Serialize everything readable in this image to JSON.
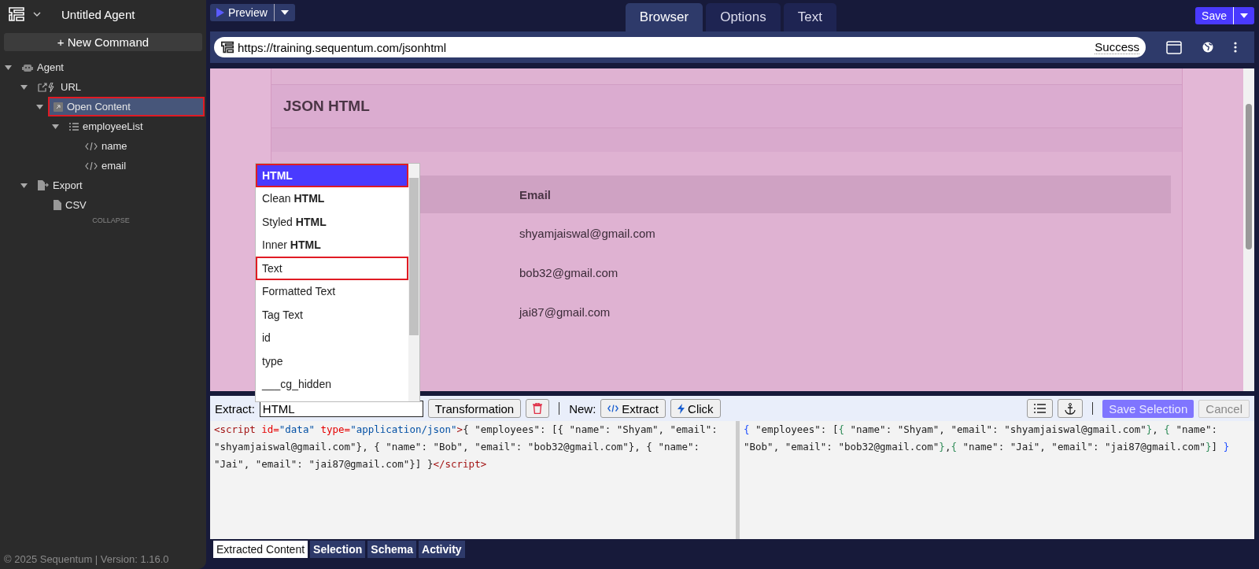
{
  "sidebar": {
    "agent_name": "Untitled Agent",
    "new_command": "+ New Command",
    "tree": [
      {
        "label": "Agent",
        "kind": "robot",
        "expanded": true,
        "selected": false,
        "annotated": false,
        "children": [
          {
            "label": "URL",
            "kind": "url",
            "expanded": true,
            "selected": false,
            "annotated": false,
            "children": [
              {
                "label": "Open Content",
                "kind": "open",
                "expanded": true,
                "selected": true,
                "annotated": true,
                "children": [
                  {
                    "label": "employeeList",
                    "kind": "list",
                    "expanded": true,
                    "selected": false,
                    "annotated": false,
                    "children": [
                      {
                        "label": "name",
                        "kind": "code",
                        "selected": false,
                        "annotated": false
                      },
                      {
                        "label": "email",
                        "kind": "code",
                        "selected": false,
                        "annotated": false
                      }
                    ]
                  }
                ]
              }
            ]
          },
          {
            "label": "Export",
            "kind": "export",
            "expanded": true,
            "selected": false,
            "annotated": false,
            "children": [
              {
                "label": "CSV",
                "kind": "file",
                "selected": false,
                "annotated": false
              }
            ]
          }
        ]
      }
    ],
    "collapse": "COLLAPSE",
    "footer": "© 2025 Sequentum | Version: 1.16.0"
  },
  "toolbar": {
    "preview": "Preview",
    "save": "Save"
  },
  "tabs": [
    {
      "label": "Browser",
      "selected": true
    },
    {
      "label": "Options",
      "selected": false
    },
    {
      "label": "Text",
      "selected": false
    }
  ],
  "address_bar": {
    "url": "https://training.sequentum.com/jsonhtml",
    "status": "Success"
  },
  "web_page": {
    "title": "JSON HTML",
    "column": "Email",
    "rows": [
      "shyamjaiswal@gmail.com",
      "bob32@gmail.com",
      "jai87@gmail.com"
    ]
  },
  "dropdown": [
    {
      "label": "HTML",
      "selected": true,
      "annotated": true
    },
    {
      "label": "Clean **HTML**",
      "selected": false,
      "annotated": false
    },
    {
      "label": "Styled **HTML**",
      "selected": false,
      "annotated": false
    },
    {
      "label": "Inner **HTML**",
      "selected": false,
      "annotated": false
    },
    {
      "label": "Text",
      "selected": false,
      "annotated": true
    },
    {
      "label": "Formatted Text",
      "selected": false,
      "annotated": false
    },
    {
      "label": "Tag Text",
      "selected": false,
      "annotated": false
    },
    {
      "label": "id",
      "selected": false,
      "annotated": false
    },
    {
      "label": "type",
      "selected": false,
      "annotated": false
    },
    {
      "label": "___cg_hidden",
      "selected": false,
      "annotated": false
    }
  ],
  "extract_bar": {
    "label": "Extract:",
    "value": "HTML",
    "transformation": "Transformation",
    "new_label": "New:",
    "extract": "Extract",
    "click": "Click",
    "save_selection": "Save Selection",
    "cancel": "Cancel"
  },
  "source_code": [
    {
      "kind": "tag",
      "text": "<script "
    },
    {
      "kind": "attr",
      "text": "id="
    },
    {
      "kind": "string",
      "text": "\"data\" "
    },
    {
      "kind": "attr",
      "text": "type="
    },
    {
      "kind": "string",
      "text": "\"application/json\""
    },
    {
      "kind": "tag",
      "text": ">"
    },
    {
      "kind": "text",
      "text": "{ \"employees\": [{ \"name\": \"Shyam\", \"email\": \"shyamjaiswal@gmail.com\"}, { \"name\": \"Bob\", \"email\": \"bob32@gmail.com\"}, { \"name\": \"Jai\", \"email\": \"jai87@gmail.com\"}] }"
    },
    {
      "kind": "tag",
      "text": "</script>"
    }
  ],
  "result_code": [
    {
      "kind": "brace",
      "text": "{"
    },
    {
      "kind": "text",
      "text": " \"employees\": ["
    },
    {
      "kind": "bracket",
      "text": "{"
    },
    {
      "kind": "text",
      "text": " \"name\": \"Shyam\", \"email\": \"shyamjaiswal@gmail.com\""
    },
    {
      "kind": "bracket",
      "text": "}"
    },
    {
      "kind": "text",
      "text": ", "
    },
    {
      "kind": "bracket",
      "text": "{"
    },
    {
      "kind": "text",
      "text": " \"name\": \"Bob\", \"email\": \"bob32@gmail.com\""
    },
    {
      "kind": "bracket",
      "text": "}"
    },
    {
      "kind": "text",
      "text": ","
    },
    {
      "kind": "bracket",
      "text": "{"
    },
    {
      "kind": "text",
      "text": " \"name\": \"Jai\", \"email\": \"jai87@gmail.com\""
    },
    {
      "kind": "bracket",
      "text": "}"
    },
    {
      "kind": "text",
      "text": "] "
    },
    {
      "kind": "brace",
      "text": "}"
    }
  ],
  "bottom_tabs": [
    {
      "label": "Extracted Content",
      "selected": true
    },
    {
      "label": "Selection",
      "selected": false
    },
    {
      "label": "Schema",
      "selected": false
    },
    {
      "label": "Activity",
      "selected": false
    }
  ]
}
